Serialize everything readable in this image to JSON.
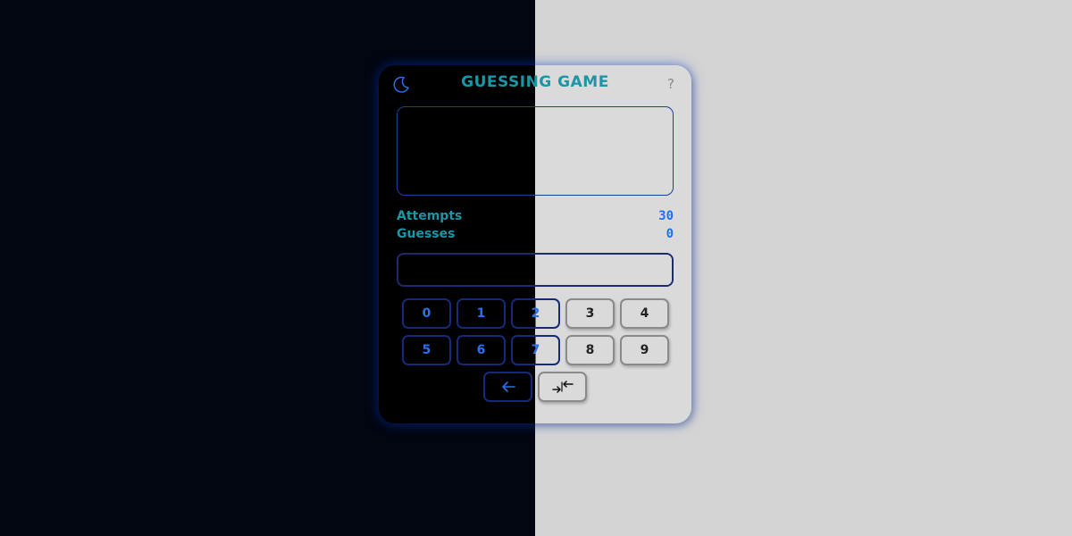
{
  "title": "GUESSING GAME",
  "help_label": "?",
  "stats": [
    {
      "label": "Attempts",
      "value": "30"
    },
    {
      "label": "Guesses",
      "value": "0"
    }
  ],
  "input": {
    "value": "",
    "placeholder": ""
  },
  "display_text": "",
  "keys": [
    "0",
    "1",
    "2",
    "3",
    "4",
    "5",
    "6",
    "7",
    "8",
    "9"
  ],
  "actions": {
    "backspace_icon": "arrow-left-icon",
    "submit_icon": "arrows-converge-icon"
  },
  "theme_icon": "moon-icon",
  "colors": {
    "accent_teal": "#1a96a6",
    "accent_blue": "#1e6fff",
    "dark_bg": "#020611",
    "light_bg": "#d4d4d4",
    "card_dark": "#000000",
    "card_light": "#dadada"
  }
}
